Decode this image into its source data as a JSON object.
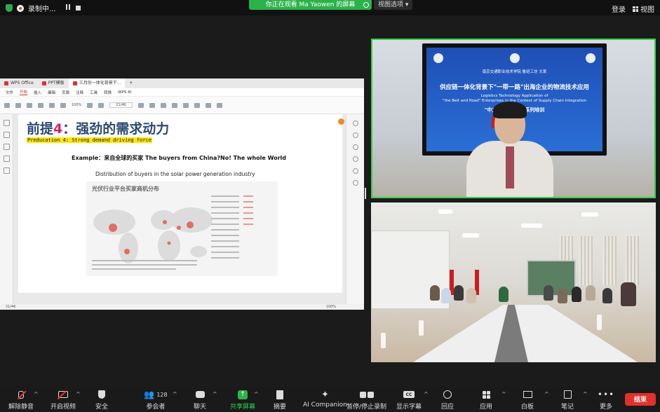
{
  "top": {
    "recording_label": "录制中...",
    "viewing_banner": "你正在观看 Ma Yaowen 的屏幕",
    "view_options": "视图选项",
    "login": "登录",
    "view": "视图"
  },
  "shared_screen": {
    "tabs": [
      "WPS Office",
      "PPT模板",
      "三月份一体化背景下..."
    ],
    "menu": [
      "文件",
      "开始",
      "插入",
      "编辑",
      "页面",
      "注释",
      "工具",
      "转换",
      "WPS AI"
    ],
    "zoom": "100%",
    "page_indicator": "21/46",
    "slide": {
      "title_prefix": "前提",
      "title_num": "4",
      "title_suffix": "：强劲的需求动力",
      "subtitle": "Preducation 4: Strong demand driving force",
      "example": "Example：来自全球的买家 The buyers from China?No! The whole World",
      "distribution": "Distribution of buyers in the solar power generation industry",
      "chart_title": "光伏行业平台买家商机分布"
    }
  },
  "video1": {
    "line1": "南京交通职业技术学院  鲁班工坊  文莱",
    "line2": "供应链一体化背景下\"一带一路\"出海企业的物流技术应用",
    "line3a": "Logistics Technology Application of",
    "line3b": "\"the Belt and Road\" Enterprises in the Context of Supply Chain Integration",
    "line4": "\"中文+职业技能\" 系列培训"
  },
  "toolbar": {
    "unmute": "解除静音",
    "start_video": "开启视频",
    "security": "安全",
    "participants": "参会者",
    "participant_count": "128",
    "chat": "聊天",
    "share_screen": "共享屏幕",
    "summary": "摘要",
    "ai_companion": "AI Companion",
    "pause_recording": "暂停/停止录制",
    "captions": "显示字幕",
    "reactions": "回应",
    "apps": "应用",
    "whiteboard": "白板",
    "notes": "笔记",
    "more": "更多",
    "end": "结束"
  }
}
